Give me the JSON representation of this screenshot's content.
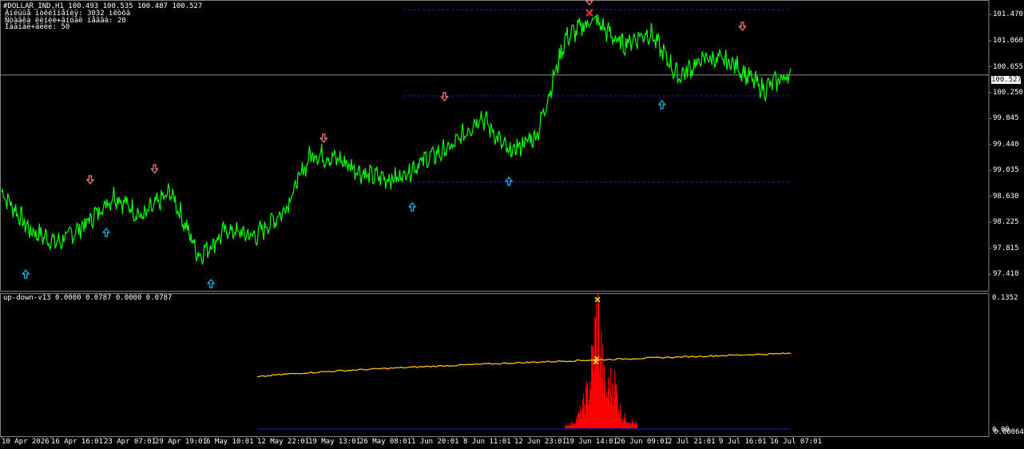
{
  "main": {
    "header_line1": "#DOLLAR_IND,H1  100.493 100.535 100.487 100.527",
    "header_line2": "Âíëüûå íòêëîíåíèÿ: 3032 ìêòôâ",
    "header_line3": "Ñòàâêà ëèíèè+ãíóàë ïåããà: 20",
    "header_line4": "Ìàãíàë+âëèè: 50",
    "price_ticks": [
      "101.470",
      "101.060",
      "100.655",
      "100.250",
      "99.845",
      "99.440",
      "99.035",
      "98.630",
      "98.225",
      "97.815",
      "97.410"
    ],
    "current_price": "100.527",
    "colors": {
      "price_line": "#00ff00",
      "arrow_up": "#00bfff",
      "arrow_down": "#ff8080",
      "level": "#2020d0",
      "background": "#000000"
    }
  },
  "indicator": {
    "label": "up-down-v13 0.0000 0.0787 0.0000 0.0787",
    "top_tick": "0.1352",
    "bottom_tick_a": "0.00",
    "bottom_tick_b": "0.00064",
    "colors": {
      "histogram": "#ff0000",
      "line": "#ffc000",
      "marker": "#ffd700"
    }
  },
  "time_axis": [
    "10 Apr 2026",
    "16 Apr 16:01",
    "23 Apr 07:01",
    "29 Apr 19:01",
    "6 May 10:01",
    "12 May 22:01",
    "19 May 13:01",
    "26 May 08:01",
    "1 Jun 20:01",
    "8 Jun 11:01",
    "12 Jun 23:01",
    "19 Jun 14:01",
    "26 Jun 09:01",
    "2 Jul 21:01",
    "9 Jul 16:01",
    "16 Jul 07:01"
  ],
  "chart_data": [
    {
      "type": "line",
      "x": [
        "10 Apr",
        "14 Apr",
        "17 Apr",
        "21 Apr",
        "24 Apr",
        "28 Apr",
        "1 May",
        "5 May",
        "8 May",
        "12 May",
        "15 May",
        "19 May",
        "22 May",
        "26 May",
        "29 May",
        "2 Jun",
        "5 Jun",
        "9 Jun",
        "12 Jun",
        "16 Jun",
        "19 Jun",
        "23 Jun",
        "26 Jun",
        "30 Jun",
        "3 Jul",
        "7 Jul",
        "10 Jul",
        "14 Jul",
        "17 Jul"
      ],
      "series": [
        {
          "values": [
            98.7,
            98.1,
            97.9,
            98.2,
            98.65,
            98.3,
            98.7,
            97.7,
            98.1,
            98.0,
            98.4,
            99.3,
            99.2,
            98.95,
            98.9,
            99.2,
            99.4,
            99.9,
            99.3,
            99.6,
            101.1,
            101.4,
            101.0,
            101.2,
            100.5,
            100.8,
            100.7,
            100.3,
            100.55
          ]
        }
      ],
      "ylim": [
        97.3,
        101.6
      ],
      "hlines": [
        101.55,
        100.2,
        98.85
      ],
      "current_price": 100.527,
      "arrows": [
        {
          "dir": "up",
          "x": "13 Apr",
          "y": 97.55
        },
        {
          "dir": "down",
          "x": "21 Apr",
          "y": 98.75
        },
        {
          "dir": "up",
          "x": "23 Apr",
          "y": 98.2
        },
        {
          "dir": "down",
          "x": "29 Apr",
          "y": 98.92
        },
        {
          "dir": "up",
          "x": "6 May",
          "y": 97.4
        },
        {
          "dir": "down",
          "x": "20 May",
          "y": 99.4
        },
        {
          "dir": "up",
          "x": "31 May",
          "y": 98.6
        },
        {
          "dir": "down",
          "x": "4 Jun",
          "y": 100.05
        },
        {
          "dir": "up",
          "x": "12 Jun",
          "y": 99.0
        },
        {
          "dir": "down",
          "x": "22 Jun",
          "y": 101.55
        },
        {
          "dir": "up",
          "x": "1 Jul",
          "y": 100.2
        },
        {
          "dir": "down",
          "x": "11 Jul",
          "y": 101.15
        }
      ]
    },
    {
      "type": "area",
      "ylim": [
        0,
        0.1352
      ],
      "histogram": [
        {
          "x": "19 Jun",
          "v": 0.003
        },
        {
          "x": "20 Jun",
          "v": 0.006
        },
        {
          "x": "21 Jun",
          "v": 0.02
        },
        {
          "x": "22 Jun",
          "v": 0.05
        },
        {
          "x": "23 Jun",
          "v": 0.1352
        },
        {
          "x": "24 Jun",
          "v": 0.04
        },
        {
          "x": "25 Jun",
          "v": 0.06
        },
        {
          "x": "26 Jun",
          "v": 0.015
        },
        {
          "x": "28 Jun",
          "v": 0.004
        }
      ],
      "line": {
        "start": 0.0535,
        "end": 0.0787
      },
      "markers": [
        0.1352,
        0.073,
        0.07
      ]
    }
  ]
}
